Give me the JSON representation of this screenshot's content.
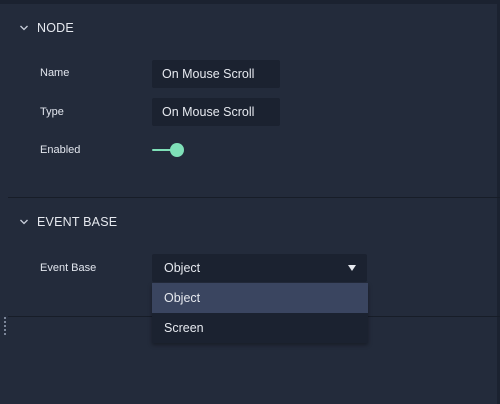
{
  "node_section": {
    "title": "NODE",
    "fields": {
      "name": {
        "label": "Name",
        "value": "On Mouse Scroll"
      },
      "type": {
        "label": "Type",
        "value": "On Mouse Scroll"
      },
      "enabled": {
        "label": "Enabled",
        "value": true
      }
    }
  },
  "event_base_section": {
    "title": "EVENT BASE",
    "field_label": "Event Base",
    "selected": "Object",
    "options": [
      "Object",
      "Screen"
    ]
  },
  "colors": {
    "background": "#232b3b",
    "field_background": "#1b2230",
    "accent": "#7fe0b8",
    "highlight": "#3a4560"
  },
  "icons": {
    "section_toggle": "chevron-down-icon",
    "select_caret": "caret-down-icon"
  }
}
